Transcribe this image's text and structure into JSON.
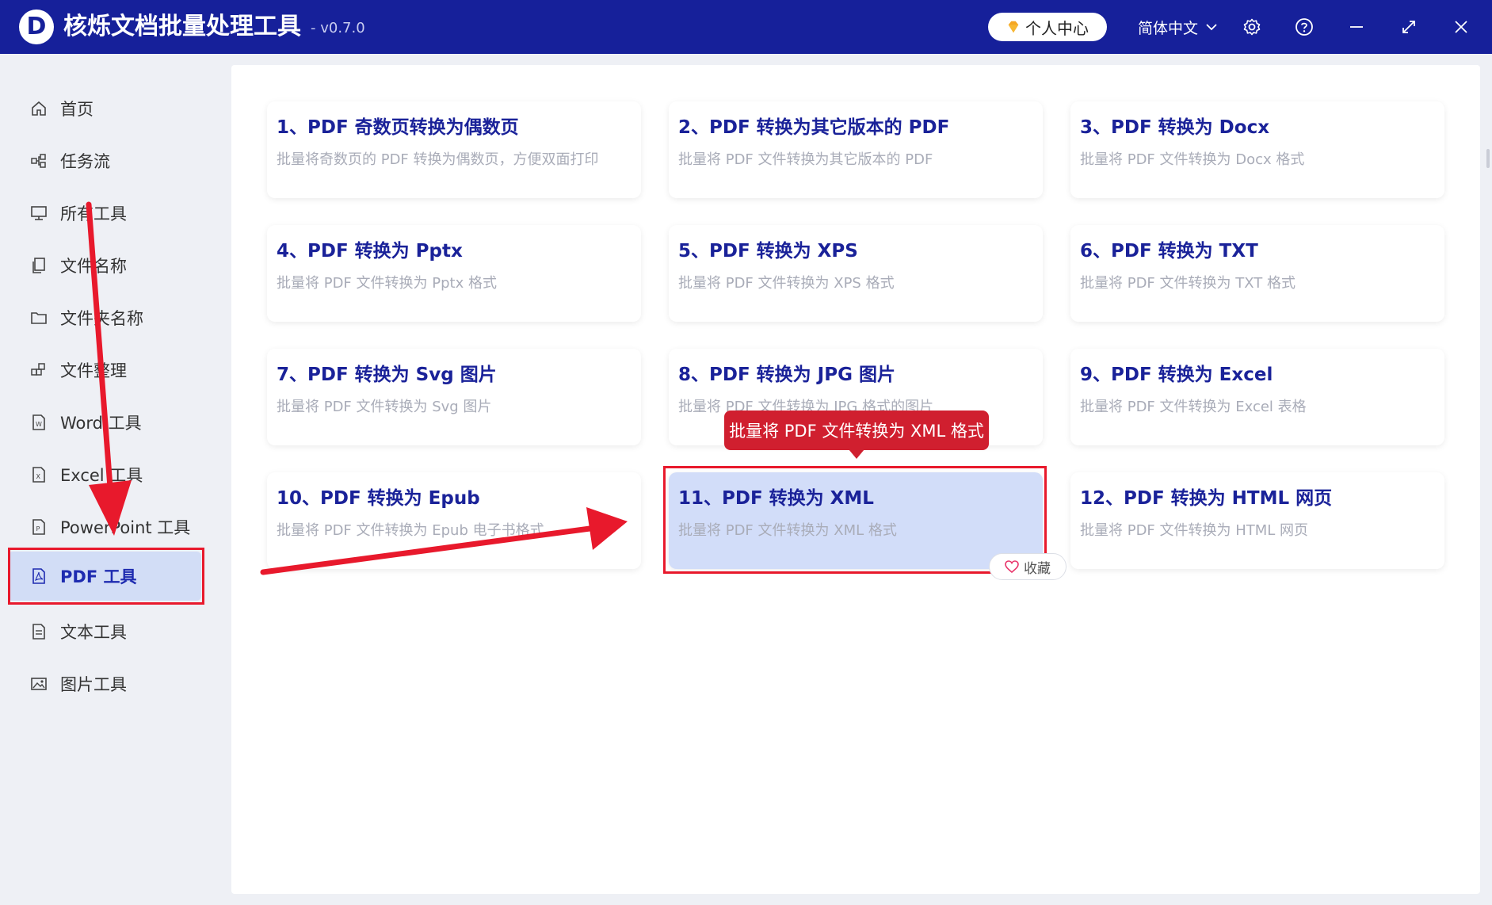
{
  "app": {
    "title": "核烁文档批量处理工具",
    "version": "- v0.7.0",
    "user_center": "个人中心",
    "language": "简体中文",
    "colors": {
      "titlebar": "#16209a",
      "accent": "#1e2bb0",
      "highlight": "#d2ddf9",
      "annotation_red": "#e8192c"
    }
  },
  "sidebar": {
    "items": [
      {
        "label": "首页",
        "icon": "home-icon"
      },
      {
        "label": "任务流",
        "icon": "workflow-icon"
      },
      {
        "label": "所有工具",
        "icon": "monitor-icon"
      },
      {
        "label": "文件名称",
        "icon": "file-copy-icon"
      },
      {
        "label": "文件夹名称",
        "icon": "folder-icon"
      },
      {
        "label": "文件整理",
        "icon": "organize-icon"
      },
      {
        "label": "Word 工具",
        "icon": "word-file-icon"
      },
      {
        "label": "Excel 工具",
        "icon": "excel-file-icon"
      },
      {
        "label": "PowerPoint 工具",
        "icon": "ppt-file-icon"
      },
      {
        "label": "PDF 工具",
        "icon": "pdf-file-icon",
        "active": true
      },
      {
        "label": "文本工具",
        "icon": "text-file-icon"
      },
      {
        "label": "图片工具",
        "icon": "image-icon"
      }
    ]
  },
  "cards": [
    {
      "title": "1、PDF 奇数页转换为偶数页",
      "desc": "批量将奇数页的 PDF 转换为偶数页，方便双面打印"
    },
    {
      "title": "2、PDF 转换为其它版本的 PDF",
      "desc": "批量将 PDF 文件转换为其它版本的 PDF"
    },
    {
      "title": "3、PDF 转换为 Docx",
      "desc": "批量将 PDF 文件转换为 Docx 格式"
    },
    {
      "title": "4、PDF 转换为 Pptx",
      "desc": "批量将 PDF 文件转换为 Pptx 格式"
    },
    {
      "title": "5、PDF 转换为 XPS",
      "desc": "批量将 PDF 文件转换为 XPS 格式"
    },
    {
      "title": "6、PDF 转换为 TXT",
      "desc": "批量将 PDF 文件转换为 TXT 格式"
    },
    {
      "title": "7、PDF 转换为 Svg 图片",
      "desc": "批量将 PDF 文件转换为 Svg 图片"
    },
    {
      "title": "8、PDF 转换为 JPG 图片",
      "desc": "批量将 PDF 文件转换为 JPG 格式的图片"
    },
    {
      "title": "9、PDF 转换为 Excel",
      "desc": "批量将 PDF 文件转换为 Excel 表格"
    },
    {
      "title": "10、PDF 转换为 Epub",
      "desc": "批量将 PDF 文件转换为 Epub 电子书格式"
    },
    {
      "title": "11、PDF 转换为 XML",
      "desc": "批量将 PDF 文件转换为 XML 格式",
      "highlighted": true
    },
    {
      "title": "12、PDF 转换为 HTML 网页",
      "desc": "批量将 PDF 文件转换为 HTML 网页"
    }
  ],
  "tooltip": "批量将 PDF 文件转换为 XML 格式",
  "favorite_label": "收藏"
}
